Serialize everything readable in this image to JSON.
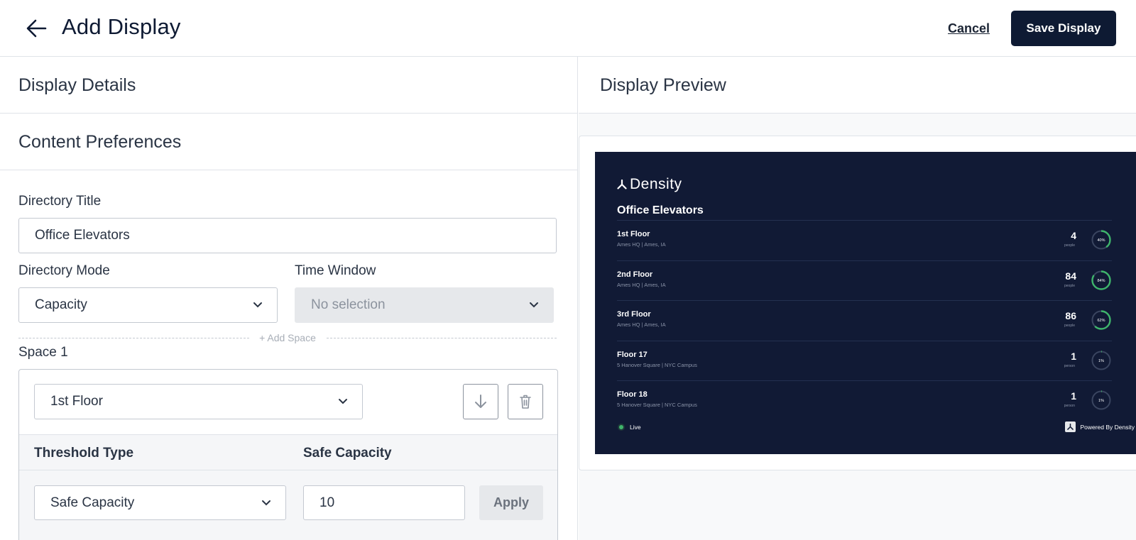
{
  "header": {
    "title": "Add Display",
    "cancel_label": "Cancel",
    "save_label": "Save Display"
  },
  "left": {
    "display_details": "Display Details",
    "content_preferences": "Content Preferences",
    "directory_title_label": "Directory Title",
    "directory_title_value": "Office Elevators",
    "directory_mode_label": "Directory Mode",
    "directory_mode_value": "Capacity",
    "time_window_label": "Time Window",
    "time_window_value": "No selection",
    "add_space": "+ Add Space",
    "space_label": "Space 1",
    "space_value": "1st Floor",
    "threshold_type_header": "Threshold Type",
    "safe_capacity_header": "Safe Capacity",
    "threshold_type_value": "Safe Capacity",
    "safe_capacity_value": "10",
    "apply_label": "Apply"
  },
  "right": {
    "display_preview": "Display Preview",
    "preview": {
      "brand": "Density",
      "title": "Office Elevators",
      "rows": [
        {
          "name": "1st Floor",
          "location": "Ames HQ | Ames, IA",
          "count": "4",
          "unit": "people",
          "percent_label": "40%",
          "percent": 40
        },
        {
          "name": "2nd Floor",
          "location": "Ames HQ | Ames, IA",
          "count": "84",
          "unit": "people",
          "percent_label": "84%",
          "percent": 84
        },
        {
          "name": "3rd Floor",
          "location": "Ames HQ | Ames, IA",
          "count": "86",
          "unit": "people",
          "percent_label": "62%",
          "percent": 62
        },
        {
          "name": "Floor 17",
          "location": "5 Hanover Square | NYC Campus",
          "count": "1",
          "unit": "person",
          "percent_label": "1%",
          "percent": 1
        },
        {
          "name": "Floor 18",
          "location": "5 Hanover Square | NYC Campus",
          "count": "1",
          "unit": "person",
          "percent_label": "1%",
          "percent": 1
        }
      ],
      "live_label": "Live",
      "powered_label": "Powered By Density"
    }
  },
  "colors": {
    "navy": "#0e1a33",
    "preview_bg": "#111a35",
    "ring_green": "#3fb56c",
    "ring_track": "#3a4560"
  },
  "icons": {
    "back": "arrow-left-icon",
    "dropdown": "chevron-down-icon",
    "move_down": "arrow-down-icon",
    "delete": "trash-icon",
    "brand": "density-logo-icon"
  }
}
